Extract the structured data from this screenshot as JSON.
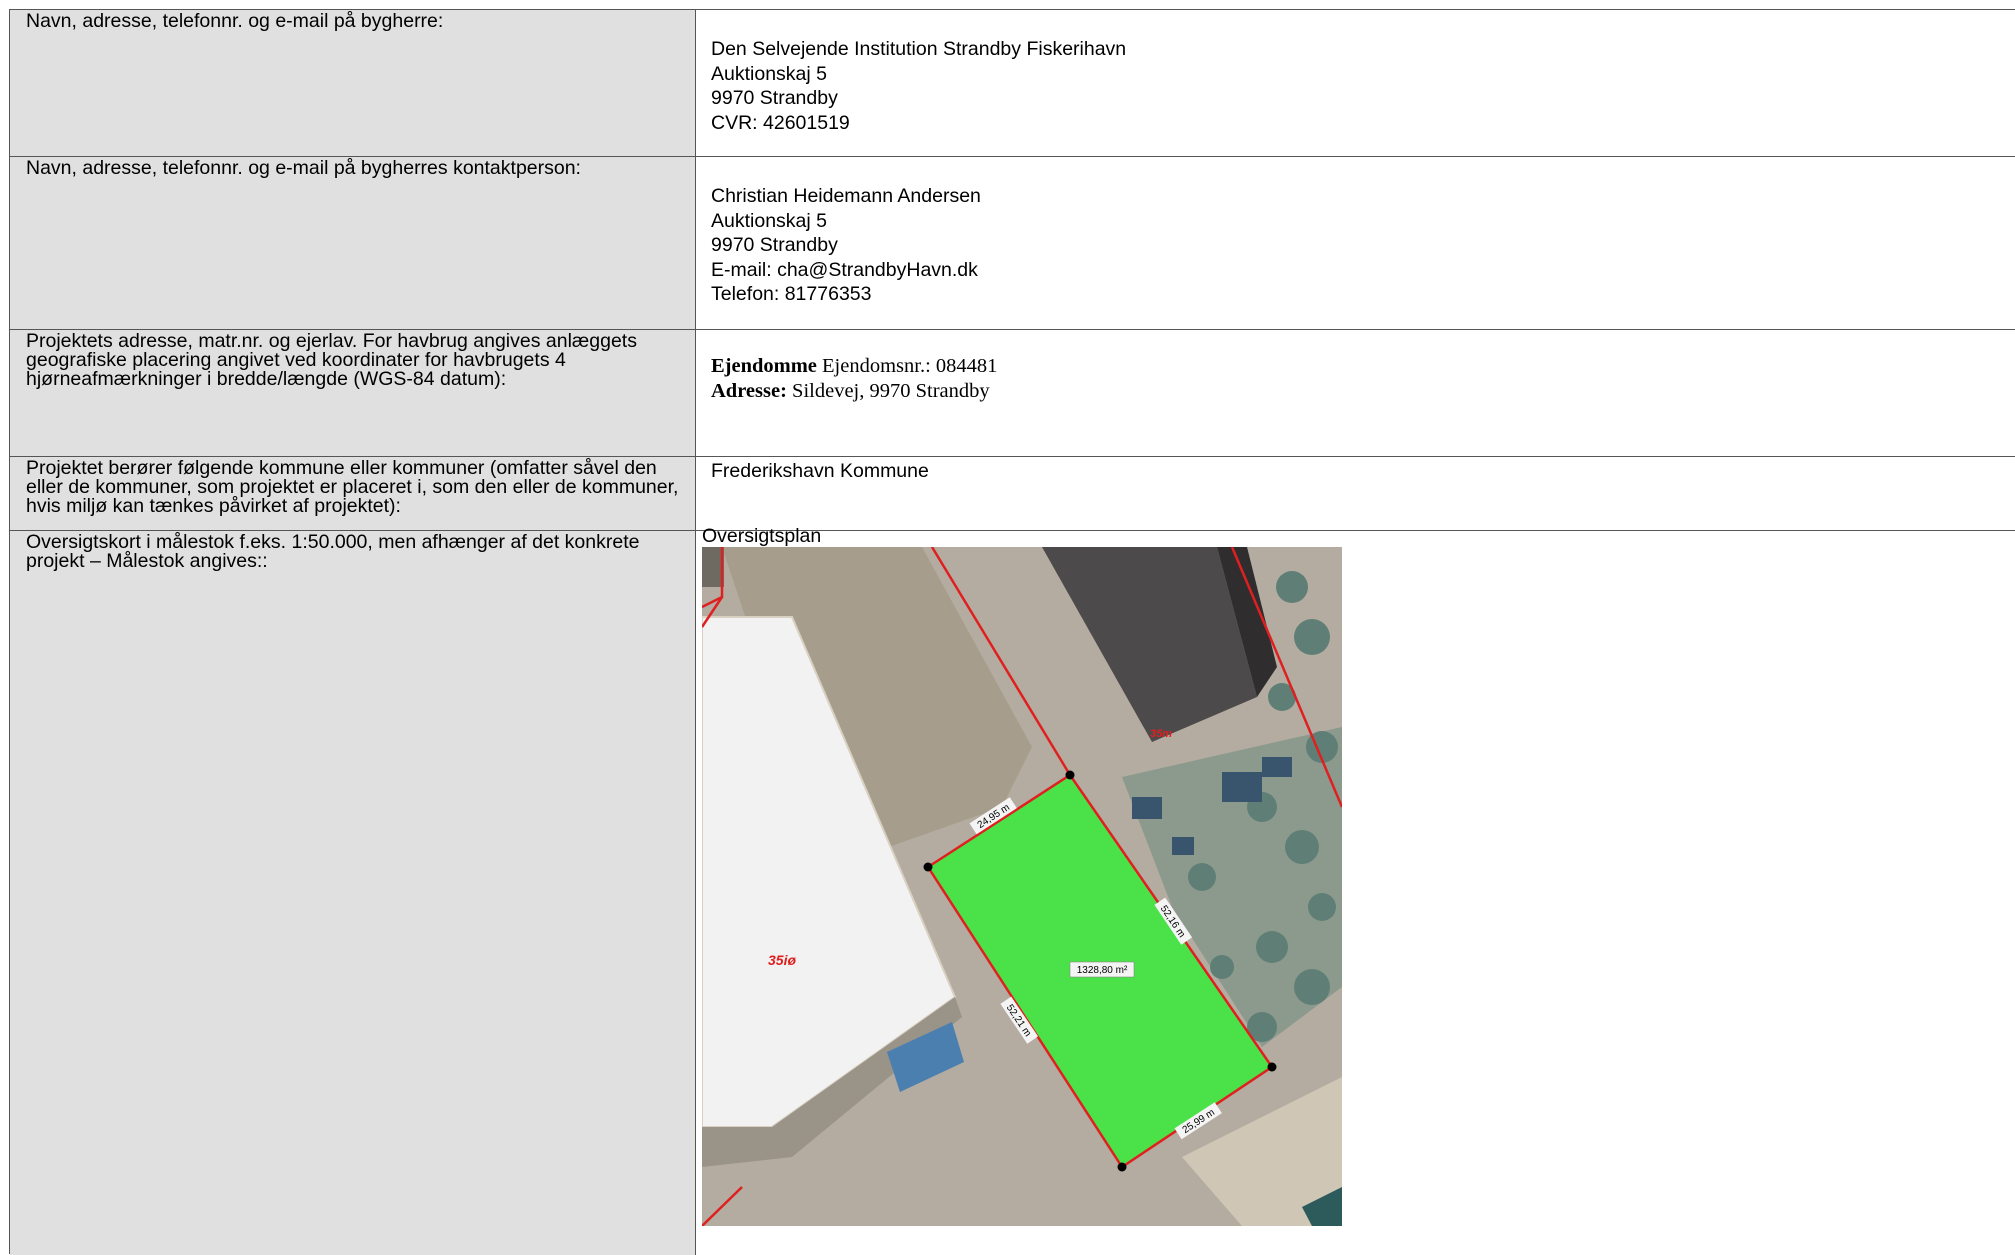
{
  "rows": [
    {
      "label": "Navn, adresse, telefonnr. og e-mail på bygherre:",
      "lines": [
        "Den Selvejende Institution Strandby Fiskerihavn",
        "Auktionskaj 5",
        "9970 Strandby",
        "CVR: 42601519"
      ]
    },
    {
      "label": "Navn, adresse, telefonnr. og e-mail på bygherres kontaktperson:",
      "lines": [
        "Christian Heidemann Andersen",
        "Auktionskaj 5",
        "9970 Strandby",
        "E-mail: cha@StrandbyHavn.dk",
        "Telefon: 81776353"
      ]
    },
    {
      "label": "Projektets adresse, matr.nr. og ejerlav. For havbrug angives anlæggets geografiske placering angivet ved koordinater for havbrugets 4 hjørneafmærkninger i bredde/længde (WGS-84 datum):",
      "property_label": "Ejendomme",
      "property_value": "Ejendomsnr.: 084481",
      "address_label": "Adresse:",
      "address_value": "Sildevej, 9970 Strandby"
    },
    {
      "label": "Projektet berører følgende kommune eller kommuner (omfatter såvel den eller de kommuner, som projektet er placeret i, som den eller de kommuner, hvis miljø kan tænkes påvirket af projektet):",
      "lines": [
        "Frederikshavn Kommune"
      ]
    },
    {
      "label": "Oversigtskort i målestok f.eks. 1:50.000, men afhænger af det konkrete projekt – Målestok angives::",
      "map_title": "Oversigtsplan"
    }
  ],
  "map": {
    "area_label": "1328,80 m²",
    "dim_top": "24,95 m",
    "dim_right": "52,16 m",
    "dim_left": "52,21 m",
    "dim_bottom": "25,99 m",
    "parcel_label_left": "35iø",
    "parcel_label_top": "35m",
    "colors": {
      "site_fill": "#3ee83e",
      "boundary": "#e02020",
      "roof": "#f2f2f2",
      "ground": "#b4aca0"
    }
  }
}
